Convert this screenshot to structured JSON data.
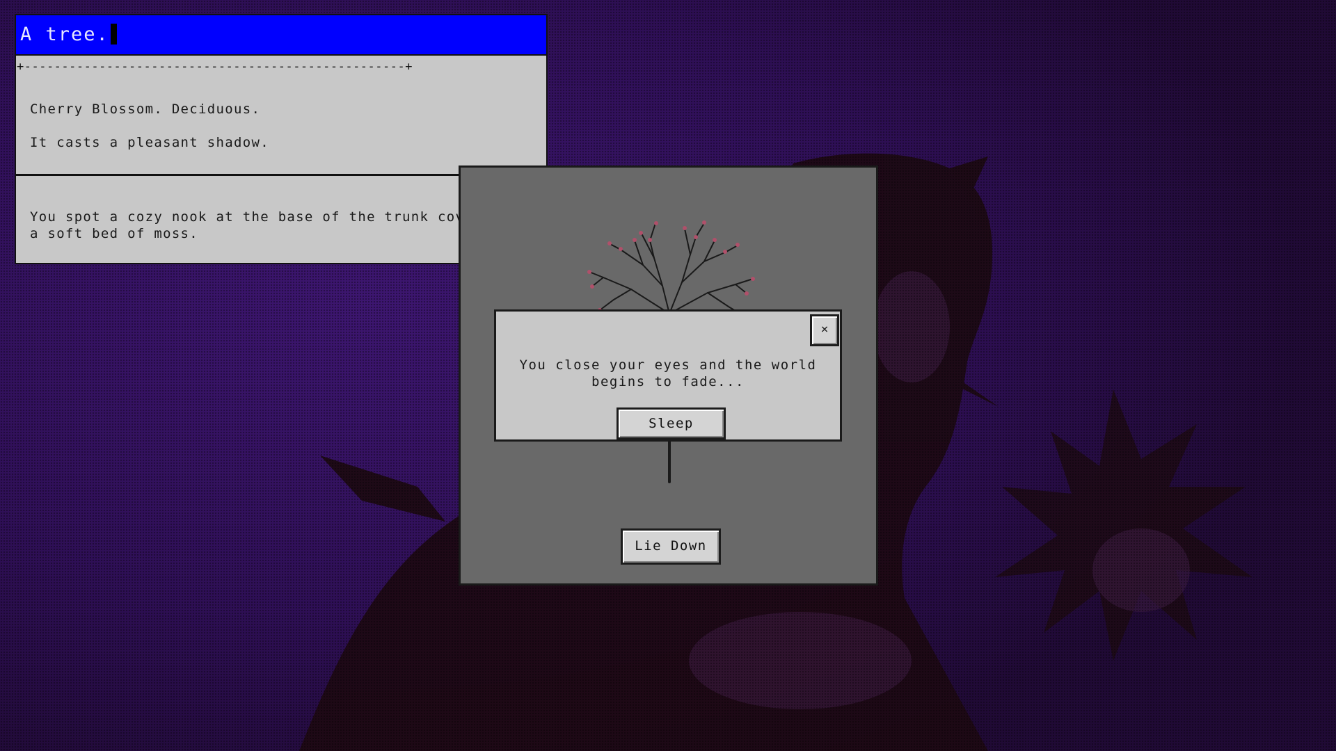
{
  "info_panel": {
    "title": "A tree.",
    "divider": "+---------------------------------------------------+",
    "lines": [
      "Cherry Blossom. Deciduous.",
      "It casts a pleasant shadow."
    ],
    "description": "You spot a cozy nook at the base of the trunk covered by a soft bed of moss."
  },
  "scene": {
    "lie_down_label": "Lie Down"
  },
  "dialog": {
    "message": "You close your eyes and the world begins to fade...",
    "close_label": "×",
    "sleep_label": "Sleep"
  },
  "colors": {
    "title_bar": "#0000ff",
    "panel_bg": "#c8c8c8",
    "scene_bg": "#696969",
    "background": "#24082c",
    "blossom": "#b0506a"
  }
}
